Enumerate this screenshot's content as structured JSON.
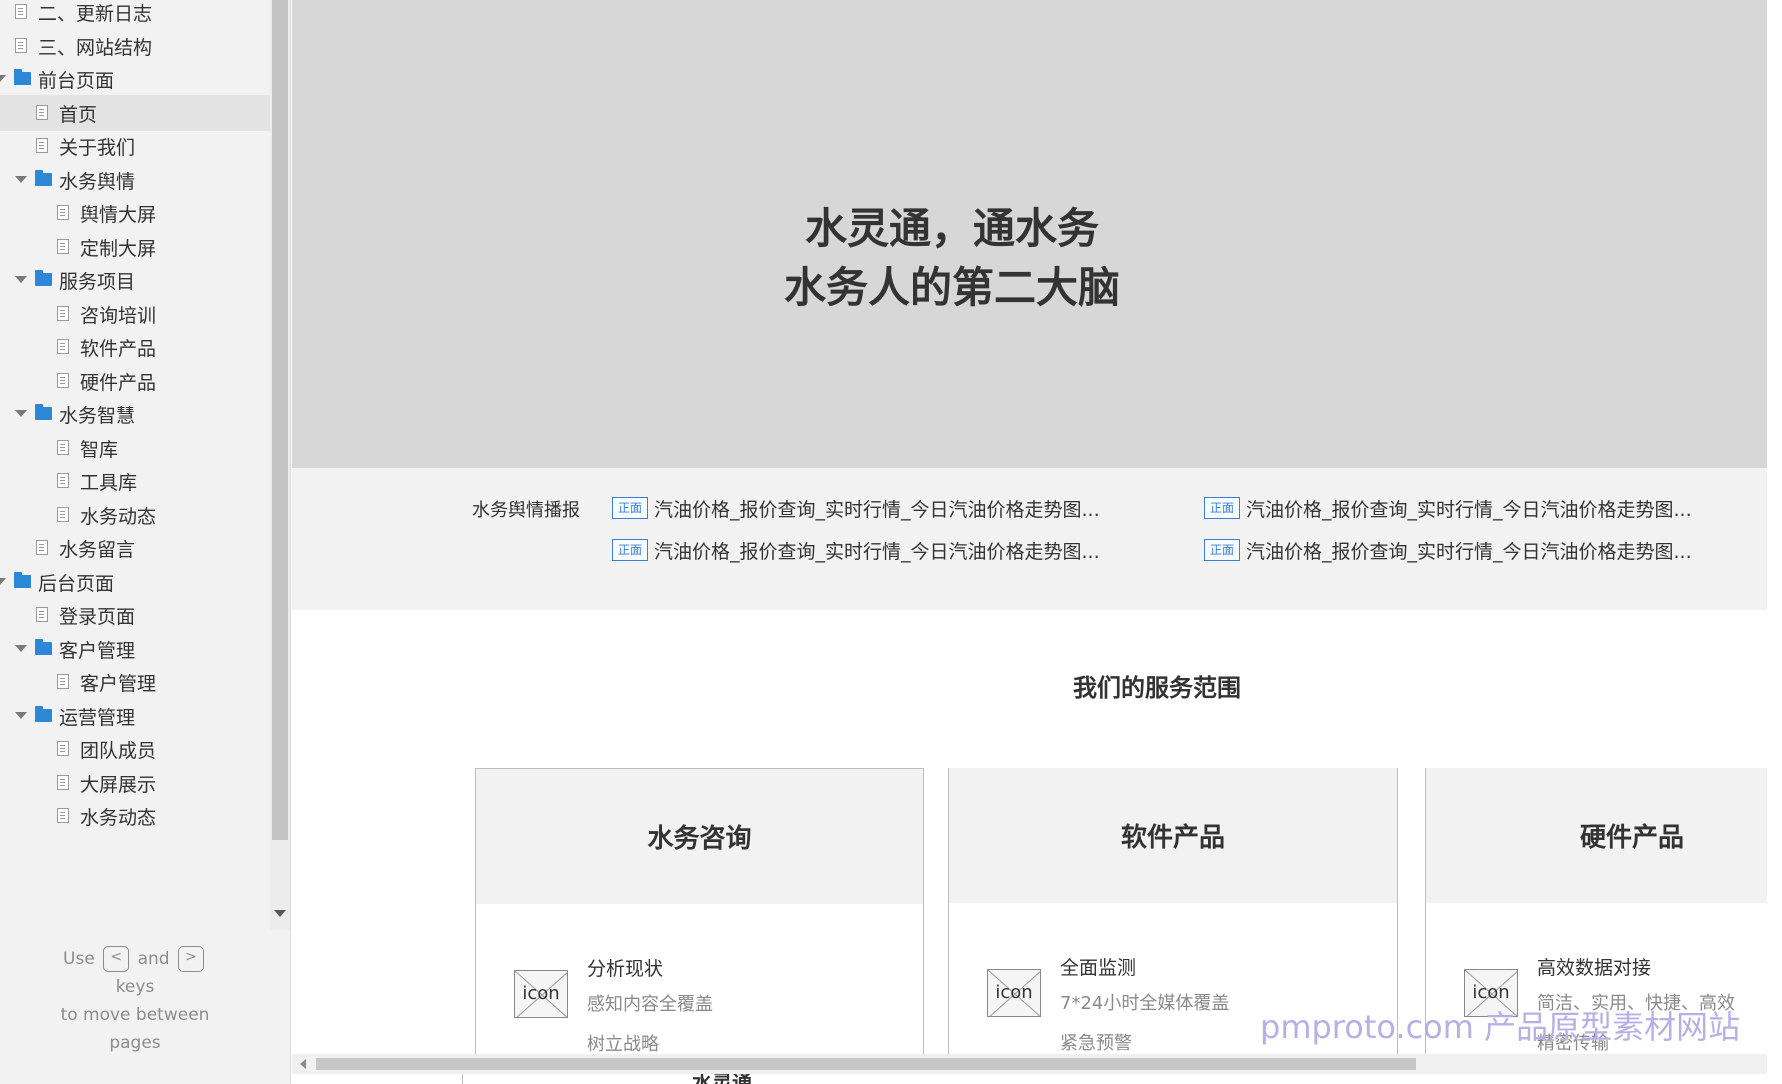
{
  "sidebar": {
    "items": [
      {
        "label": "二、更新日志",
        "type": "page",
        "depth": 0,
        "expanded": null,
        "selected": false
      },
      {
        "label": "三、网站结构",
        "type": "page",
        "depth": 0,
        "expanded": null,
        "selected": false
      },
      {
        "label": "前台页面",
        "type": "folder",
        "depth": 0,
        "expanded": true,
        "selected": false
      },
      {
        "label": "首页",
        "type": "page",
        "depth": 1,
        "expanded": null,
        "selected": true
      },
      {
        "label": "关于我们",
        "type": "page",
        "depth": 1,
        "expanded": null,
        "selected": false
      },
      {
        "label": "水务舆情",
        "type": "folder",
        "depth": 1,
        "expanded": true,
        "selected": false
      },
      {
        "label": "舆情大屏",
        "type": "page",
        "depth": 2,
        "expanded": null,
        "selected": false
      },
      {
        "label": "定制大屏",
        "type": "page",
        "depth": 2,
        "expanded": null,
        "selected": false
      },
      {
        "label": "服务项目",
        "type": "folder",
        "depth": 1,
        "expanded": true,
        "selected": false
      },
      {
        "label": "咨询培训",
        "type": "page",
        "depth": 2,
        "expanded": null,
        "selected": false
      },
      {
        "label": "软件产品",
        "type": "page",
        "depth": 2,
        "expanded": null,
        "selected": false
      },
      {
        "label": "硬件产品",
        "type": "page",
        "depth": 2,
        "expanded": null,
        "selected": false
      },
      {
        "label": "水务智慧",
        "type": "folder",
        "depth": 1,
        "expanded": true,
        "selected": false
      },
      {
        "label": "智库",
        "type": "page",
        "depth": 2,
        "expanded": null,
        "selected": false
      },
      {
        "label": "工具库",
        "type": "page",
        "depth": 2,
        "expanded": null,
        "selected": false
      },
      {
        "label": "水务动态",
        "type": "page",
        "depth": 2,
        "expanded": null,
        "selected": false
      },
      {
        "label": "水务留言",
        "type": "page",
        "depth": 1,
        "expanded": null,
        "selected": false
      },
      {
        "label": "后台页面",
        "type": "folder",
        "depth": 0,
        "expanded": true,
        "selected": false
      },
      {
        "label": "登录页面",
        "type": "page",
        "depth": 1,
        "expanded": null,
        "selected": false
      },
      {
        "label": "客户管理",
        "type": "folder",
        "depth": 1,
        "expanded": true,
        "selected": false
      },
      {
        "label": "客户管理",
        "type": "page",
        "depth": 2,
        "expanded": null,
        "selected": false
      },
      {
        "label": "运营管理",
        "type": "folder",
        "depth": 1,
        "expanded": true,
        "selected": false
      },
      {
        "label": "团队成员",
        "type": "page",
        "depth": 2,
        "expanded": null,
        "selected": false
      },
      {
        "label": "大屏展示",
        "type": "page",
        "depth": 2,
        "expanded": null,
        "selected": false
      },
      {
        "label": "水务动态",
        "type": "page",
        "depth": 2,
        "expanded": null,
        "selected": false
      }
    ],
    "help": {
      "use": "Use",
      "prev_key": "<",
      "and": "and",
      "next_key": ">",
      "keys": "keys",
      "move1": "to move between",
      "move2": "pages"
    }
  },
  "hero": {
    "line1": "水灵通，通水务",
    "line2": "水务人的第二大脑"
  },
  "news": {
    "label": "水务舆情播报",
    "tag": "正面",
    "items": [
      "汽油价格_报价查询_实时行情_今日汽油价格走势图...",
      "汽油价格_报价查询_实时行情_今日汽油价格走势图...",
      "汽油价格_报价查询_实时行情_今日汽油价格走势图...",
      "汽油价格_报价查询_实时行情_今日汽油价格走势图..."
    ]
  },
  "services": {
    "title": "我们的服务范围",
    "icon_label": "icon",
    "cards": [
      {
        "title": "水务咨询",
        "row_title": "分析现状",
        "row_desc": "感知内容全覆盖",
        "row_next": "树立战略"
      },
      {
        "title": "软件产品",
        "row_title": "全面监测",
        "row_desc": "7*24小时全媒体覆盖",
        "row_next": "紧急预警"
      },
      {
        "title": "硬件产品",
        "row_title": "高效数据对接",
        "row_desc": "简洁、实用、快捷、高效",
        "row_next": "精密传输"
      }
    ]
  },
  "peek": {
    "text": "水灵通"
  },
  "watermark": "pmproto.com 产品原型素材网站",
  "colors": {
    "accent": "#2c87d6",
    "tag_blue": "#3b7fd4",
    "watermark": "#b7b0e6"
  }
}
